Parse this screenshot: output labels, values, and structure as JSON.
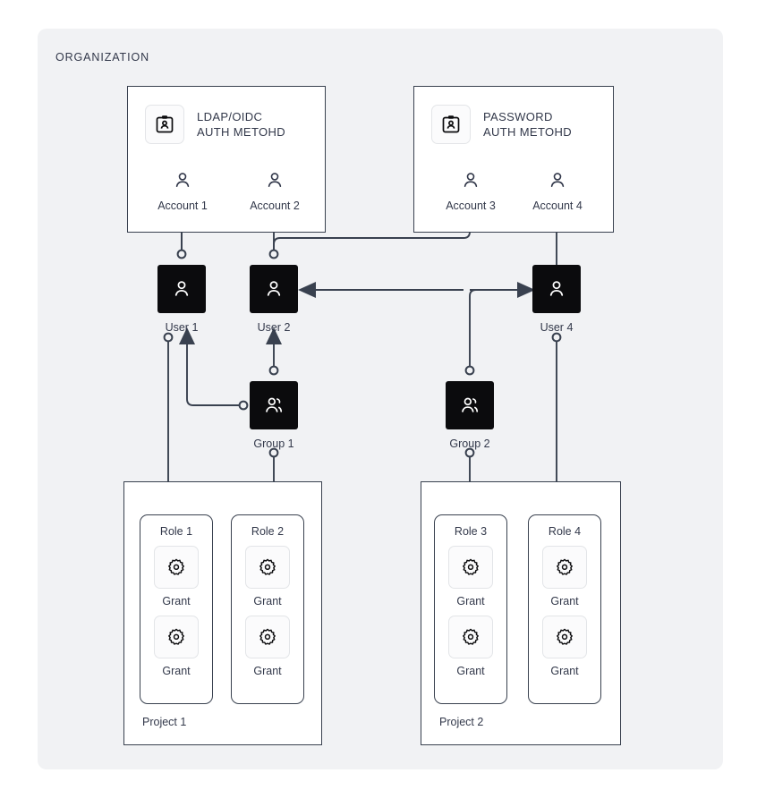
{
  "organization": {
    "title": "ORGANIZATION"
  },
  "colors": {
    "canvas": "#ffffff",
    "org_background": "#f1f2f4",
    "stroke": "#39414f",
    "node_fill": "#0b0b0d",
    "text": "#32384a",
    "tile_border": "#e3e5e8",
    "tile_fill": "#fbfbfc"
  },
  "auth_methods": [
    {
      "id": "ldap-oidc",
      "icon": "id-badge-icon",
      "label": "LDAP/OIDC\nAUTH METOHD",
      "accounts": [
        {
          "id": "account-1",
          "icon": "person-icon",
          "label": "Account 1"
        },
        {
          "id": "account-2",
          "icon": "person-icon",
          "label": "Account 2"
        }
      ]
    },
    {
      "id": "password",
      "icon": "id-badge-icon",
      "label": "PASSWORD\nAUTH METOHD",
      "accounts": [
        {
          "id": "account-3",
          "icon": "person-icon",
          "label": "Account 3"
        },
        {
          "id": "account-4",
          "icon": "person-icon",
          "label": "Account 4"
        }
      ]
    }
  ],
  "users": [
    {
      "id": "user-1",
      "icon": "user-icon",
      "label": "User 1"
    },
    {
      "id": "user-2",
      "icon": "user-icon",
      "label": "User 2"
    },
    {
      "id": "user-4",
      "icon": "user-icon",
      "label": "User 4"
    }
  ],
  "groups": [
    {
      "id": "group-1",
      "icon": "users-group-icon",
      "label": "Group 1"
    },
    {
      "id": "group-2",
      "icon": "users-group-icon",
      "label": "Group 2"
    }
  ],
  "projects": [
    {
      "id": "project-1",
      "label": "Project 1",
      "roles": [
        {
          "id": "role-1",
          "label": "Role 1",
          "grants": [
            {
              "icon": "gear-icon",
              "label": "Grant"
            },
            {
              "icon": "gear-icon",
              "label": "Grant"
            }
          ]
        },
        {
          "id": "role-2",
          "label": "Role 2",
          "grants": [
            {
              "icon": "gear-icon",
              "label": "Grant"
            },
            {
              "icon": "gear-icon",
              "label": "Grant"
            }
          ]
        }
      ]
    },
    {
      "id": "project-2",
      "label": "Project 2",
      "roles": [
        {
          "id": "role-3",
          "label": "Role 3",
          "grants": [
            {
              "icon": "gear-icon",
              "label": "Grant"
            },
            {
              "icon": "gear-icon",
              "label": "Grant"
            }
          ]
        },
        {
          "id": "role-4",
          "label": "Role 4",
          "grants": [
            {
              "icon": "gear-icon",
              "label": "Grant"
            },
            {
              "icon": "gear-icon",
              "label": "Grant"
            }
          ]
        }
      ]
    }
  ],
  "connections": [
    {
      "from": "user-1",
      "to": "account-1",
      "style": "circle-to-arrow"
    },
    {
      "from": "user-2",
      "to": "account-2",
      "style": "circle-to-arrow"
    },
    {
      "from": "user-2",
      "to": "account-3",
      "style": "circle-to-arrow-elbow"
    },
    {
      "from": "user-4",
      "to": "account-4",
      "style": "line-to-arrow"
    },
    {
      "from": "group-1",
      "to": "user-2",
      "style": "circle-to-arrow"
    },
    {
      "from": "group-1",
      "to": "user-1",
      "style": "circle-to-arrow-elbow"
    },
    {
      "from": "group-2",
      "to": "user-2",
      "style": "circle-to-arrow-split"
    },
    {
      "from": "group-2",
      "to": "user-4",
      "style": "circle-to-arrow-split"
    },
    {
      "from": "user-1",
      "to": "role-1",
      "style": "circle-to-arrow"
    },
    {
      "from": "group-1",
      "to": "role-2",
      "style": "circle-to-arrow"
    },
    {
      "from": "group-2",
      "to": "role-3",
      "style": "circle-to-arrow"
    },
    {
      "from": "user-4",
      "to": "role-4",
      "style": "circle-to-arrow"
    }
  ]
}
